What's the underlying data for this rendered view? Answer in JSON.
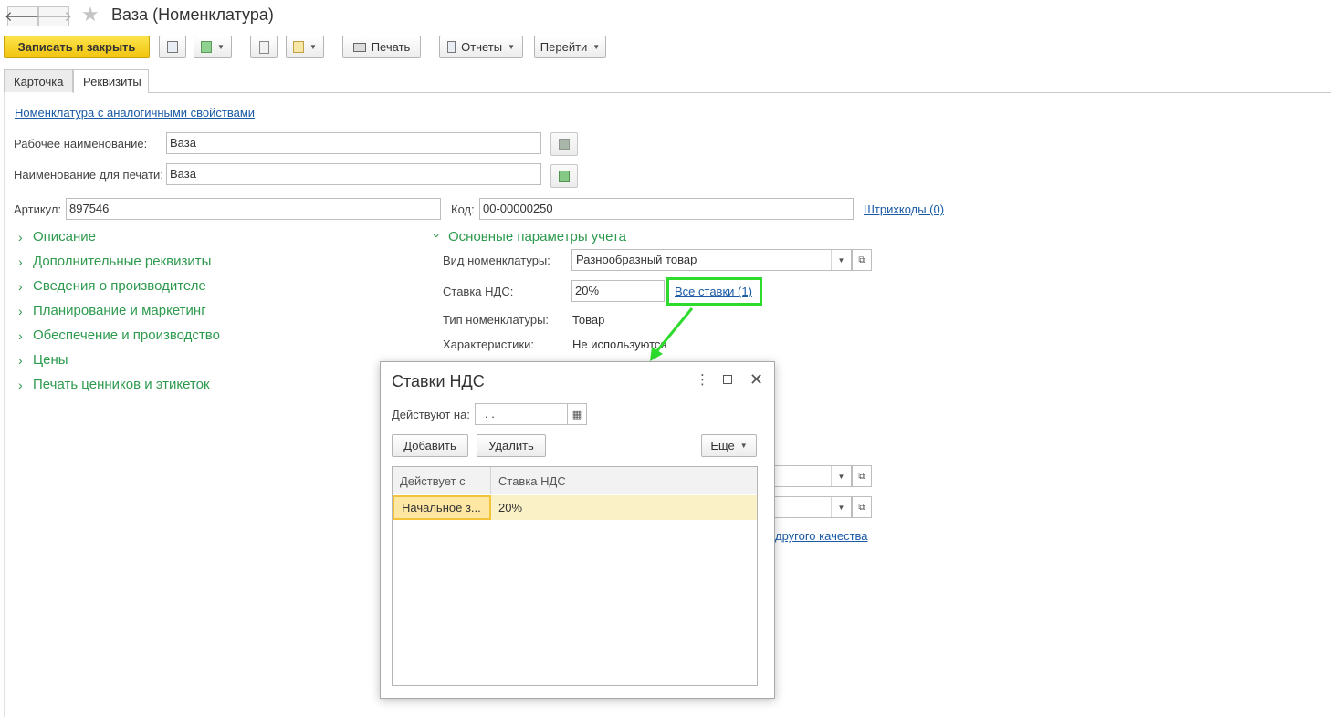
{
  "window": {
    "title": "Ваза (Номенклатура)"
  },
  "toolbar": {
    "save_close": "Записать и закрыть",
    "print": "Печать",
    "reports": "Отчеты",
    "goto": "Перейти"
  },
  "tabs": [
    {
      "label": "Карточка"
    },
    {
      "label": "Реквизиты"
    }
  ],
  "form": {
    "similar_link": "Номенклатура с аналогичными свойствами",
    "work_name_label": "Рабочее наименование:",
    "work_name_value": "Ваза",
    "print_name_label": "Наименование для печати:",
    "print_name_value": "Ваза",
    "article_label": "Артикул:",
    "article_value": "897546",
    "code_label": "Код:",
    "code_value": "00-00000250",
    "barcodes_link": "Штрихкоды (0)"
  },
  "groups": [
    {
      "label": "Описание"
    },
    {
      "label": "Дополнительные реквизиты"
    },
    {
      "label": "Сведения о производителе"
    },
    {
      "label": "Планирование и маркетинг"
    },
    {
      "label": "Обеспечение и производство"
    },
    {
      "label": "Цены"
    },
    {
      "label": "Печать ценников и этикеток"
    }
  ],
  "params": {
    "header": "Основные параметры учета",
    "kind_label": "Вид номенклатуры:",
    "kind_value": "Разнообразный товар",
    "vat_label": "Ставка НДС:",
    "vat_value": "20%",
    "all_rates_link": "Все ставки (1)",
    "type_label": "Тип номенклатуры:",
    "type_value": "Товар",
    "char_label": "Характеристики:",
    "char_value": "Не используются",
    "quality_link_partial": "другого качества"
  },
  "dialog": {
    "title": "Ставки НДС",
    "valid_on_label": "Действуют на:",
    "date_value": " .  .",
    "add_button": "Добавить",
    "delete_button": "Удалить",
    "more_button": "Еще",
    "columns": [
      "Действует с",
      "Ставка НДС"
    ],
    "rows": [
      {
        "from": "Начальное з...",
        "rate": "20%"
      }
    ]
  },
  "colors": {
    "primary_button": "#f1c40f",
    "group_green": "#2e9a4e",
    "highlight": "#2ddb2d",
    "link_blue": "#1a5aa6"
  }
}
